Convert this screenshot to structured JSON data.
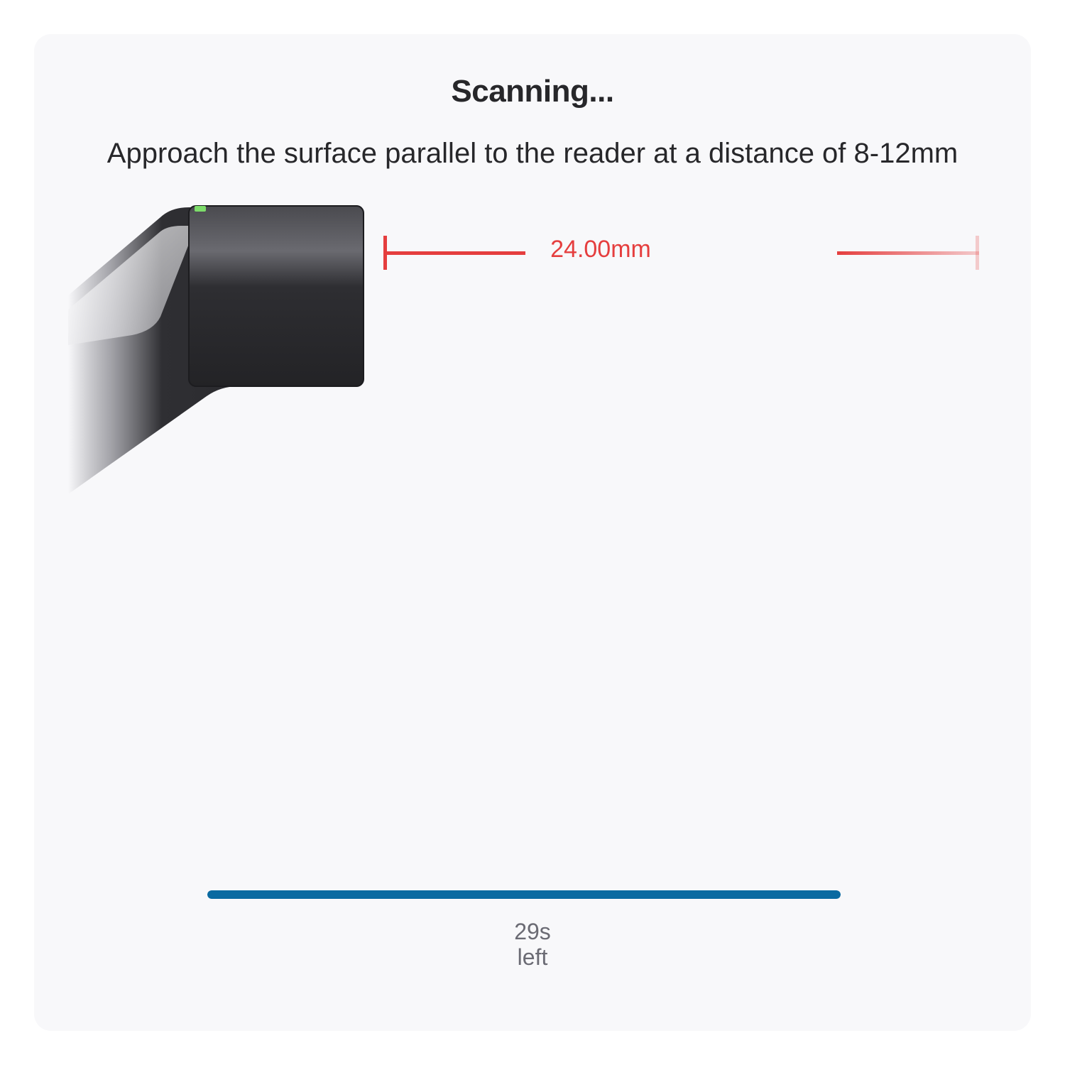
{
  "header": {
    "title": "Scanning...",
    "instruction": "Approach the surface parallel to the reader at a distance of 8-12mm"
  },
  "distance": {
    "value": "24.00mm",
    "color": "#e53e3e"
  },
  "progress": {
    "fraction": 1.0,
    "color": "#0a6aa1",
    "seconds": "29s",
    "suffix": "left"
  },
  "reader": {
    "status_light_color": "#7ddc6a"
  }
}
